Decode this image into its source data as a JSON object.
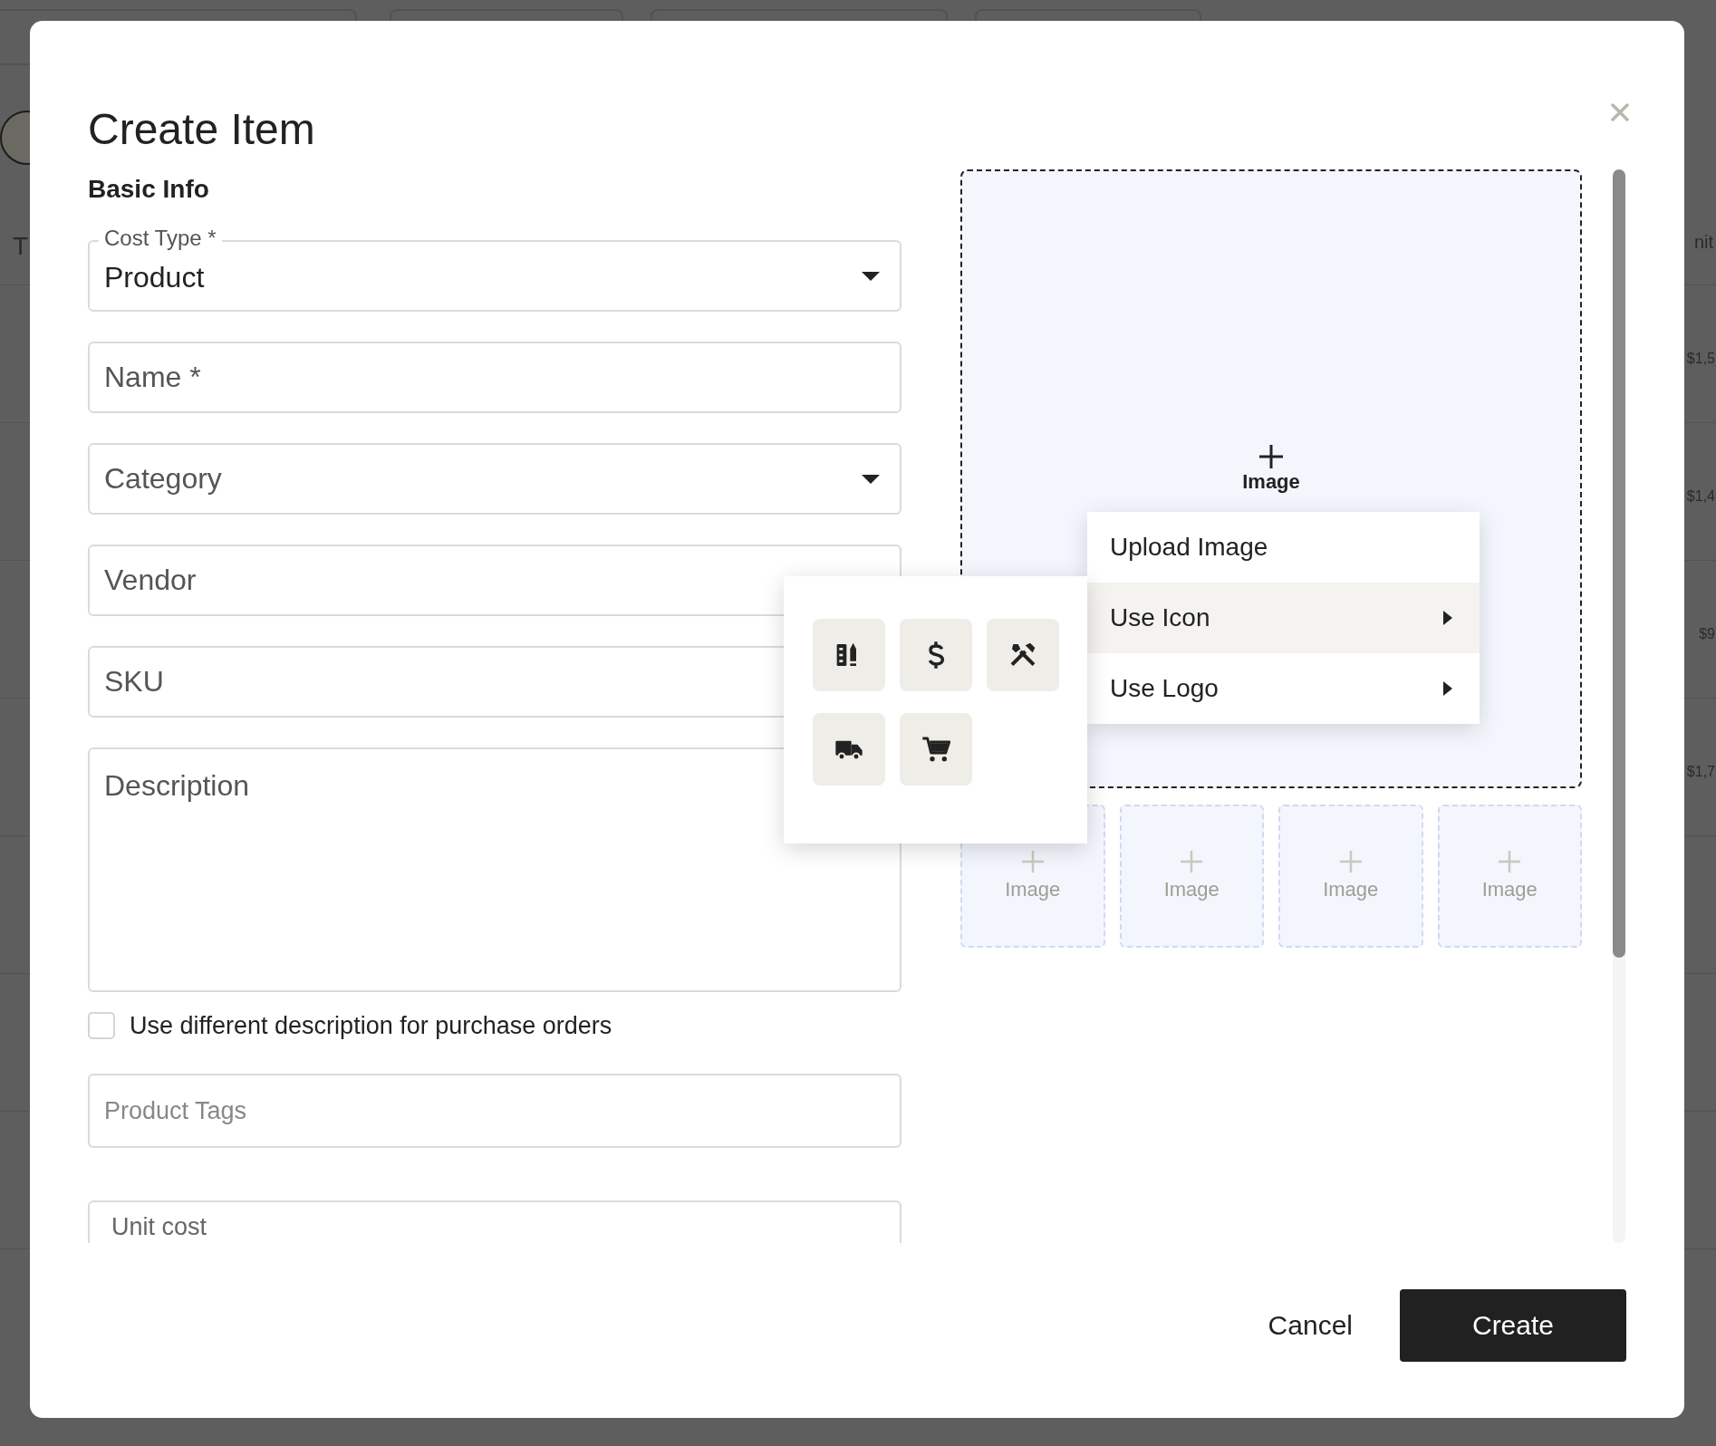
{
  "background": {
    "left_header": "T",
    "right_header": "nit",
    "rows": [
      {
        "amount": "$1,5"
      },
      {
        "amount": "$1,4"
      },
      {
        "amount": "$9"
      },
      {
        "amount": "$1,7"
      },
      {},
      {},
      {},
      {}
    ]
  },
  "dialog": {
    "title": "Create Item",
    "section": "Basic Info",
    "fields": [
      {
        "kind": "select",
        "label": "Cost Type *",
        "value": "Product"
      },
      {
        "kind": "text",
        "placeholder": "Name *"
      },
      {
        "kind": "select",
        "placeholder": "Category"
      },
      {
        "kind": "text",
        "placeholder": "Vendor"
      },
      {
        "kind": "text",
        "placeholder": "SKU"
      },
      {
        "kind": "textarea",
        "placeholder": "Description"
      },
      {
        "kind": "checkbox",
        "label": "Use different description for purchase orders",
        "checked": false
      },
      {
        "kind": "tags",
        "placeholder": "Product Tags"
      },
      {
        "kind": "text",
        "placeholder": "Unit cost"
      }
    ],
    "main_image": {
      "label": "Image"
    },
    "thumbnails": [
      {
        "label": "Image"
      },
      {
        "label": "Image"
      },
      {
        "label": "Image"
      },
      {
        "label": "Image"
      }
    ],
    "menu": [
      {
        "label": "Upload Image",
        "selected": false,
        "submenu": false
      },
      {
        "label": "Use Icon",
        "selected": true,
        "submenu": true
      },
      {
        "label": "Use Logo",
        "selected": false,
        "submenu": true
      }
    ],
    "buttons": [
      {
        "kind": "text",
        "label": "Cancel"
      },
      {
        "kind": "primary",
        "label": "Create"
      }
    ]
  }
}
